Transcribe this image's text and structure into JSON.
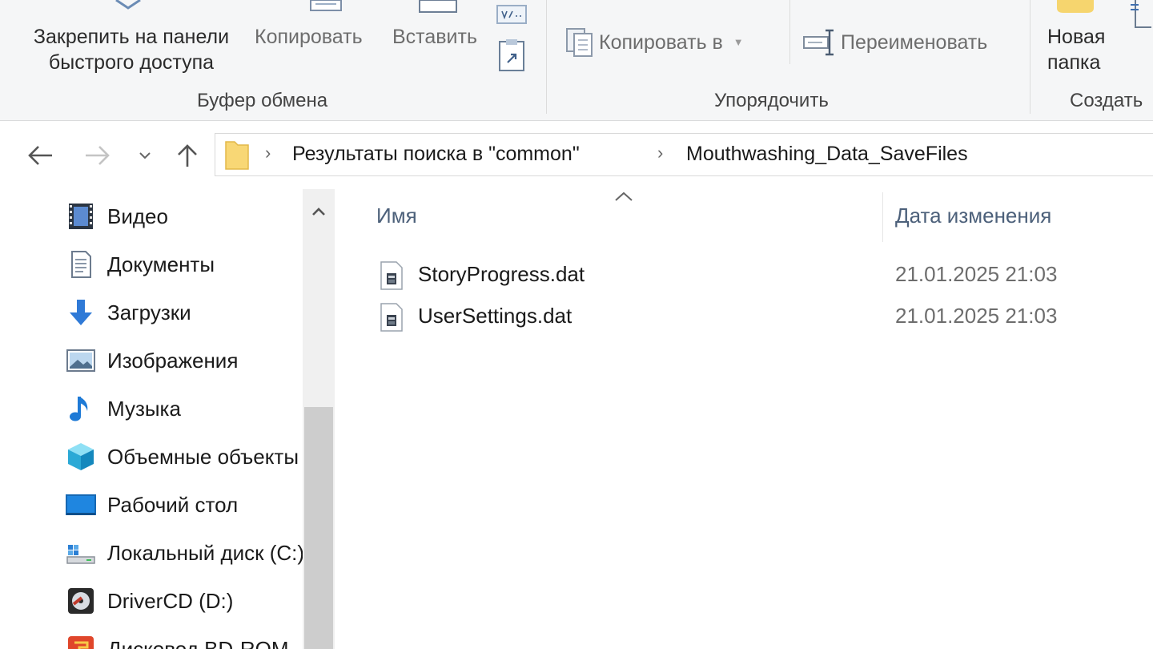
{
  "ribbon": {
    "pin_label_line1": "Закрепить на панели",
    "pin_label_line2": "быстрого доступа",
    "copy_label": "Копировать",
    "paste_label": "Вставить",
    "clipboard_group": "Буфер обмена",
    "copy_to_label": "Копировать в",
    "rename_label": "Переименовать",
    "organize_group": "Упорядочить",
    "new_folder_line1": "Новая",
    "new_folder_line2": "папка",
    "create_group": "Создать"
  },
  "address": {
    "crumbs": [
      "Результаты поиска в \"common\"",
      "Mouthwashing_Data_SaveFiles"
    ]
  },
  "nav": {
    "items": [
      {
        "label": "Видео",
        "icon": "video-icon"
      },
      {
        "label": "Документы",
        "icon": "documents-icon"
      },
      {
        "label": "Загрузки",
        "icon": "downloads-icon"
      },
      {
        "label": "Изображения",
        "icon": "pictures-icon"
      },
      {
        "label": "Музыка",
        "icon": "music-icon"
      },
      {
        "label": "Объемные объекты",
        "icon": "3d-objects-icon"
      },
      {
        "label": "Рабочий стол",
        "icon": "desktop-icon"
      },
      {
        "label": "Локальный диск (C:)",
        "icon": "local-disk-icon"
      },
      {
        "label": "DriverCD (D:)",
        "icon": "cd-drive-icon"
      },
      {
        "label": "Дисковод BD-ROM",
        "icon": "bd-rom-icon"
      }
    ]
  },
  "list": {
    "col_name": "Имя",
    "col_date": "Дата изменения",
    "files": [
      {
        "name": "StoryProgress.dat",
        "date": "21.01.2025 21:03"
      },
      {
        "name": "UserSettings.dat",
        "date": "21.01.2025 21:03"
      }
    ]
  }
}
